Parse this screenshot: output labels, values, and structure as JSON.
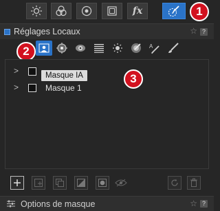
{
  "toolbar": {
    "buttons": [
      {
        "icon": "sun-icon"
      },
      {
        "icon": "color-circles-icon"
      },
      {
        "icon": "lens-icon"
      },
      {
        "icon": "crop-frame-icon"
      },
      {
        "icon": "fx-icon",
        "label": "fx"
      },
      {
        "icon": "brush-local-icon",
        "active": true
      }
    ]
  },
  "badges": {
    "one": "1",
    "two": "2",
    "three": "3"
  },
  "panel": {
    "title": "Réglages Locaux",
    "star": "☆",
    "help": "?"
  },
  "tools": [
    {
      "icon": "local-mask-tool-icon",
      "active": true
    },
    {
      "icon": "control-point-icon"
    },
    {
      "icon": "eye-lens-icon"
    },
    {
      "icon": "graduated-filter-icon"
    },
    {
      "icon": "exposure-sun-icon"
    },
    {
      "icon": "color-picker-icon"
    },
    {
      "icon": "auto-brush-icon",
      "label": "A"
    },
    {
      "icon": "brush-icon"
    }
  ],
  "masks": [
    {
      "label": "Masque IA",
      "tooltip": true
    },
    {
      "label": "Masque 1"
    }
  ],
  "footer": {
    "title": "Options de masque",
    "star": "☆",
    "help": "?"
  },
  "colors": {
    "accent": "#2a73c8",
    "badge": "#d2111f"
  }
}
